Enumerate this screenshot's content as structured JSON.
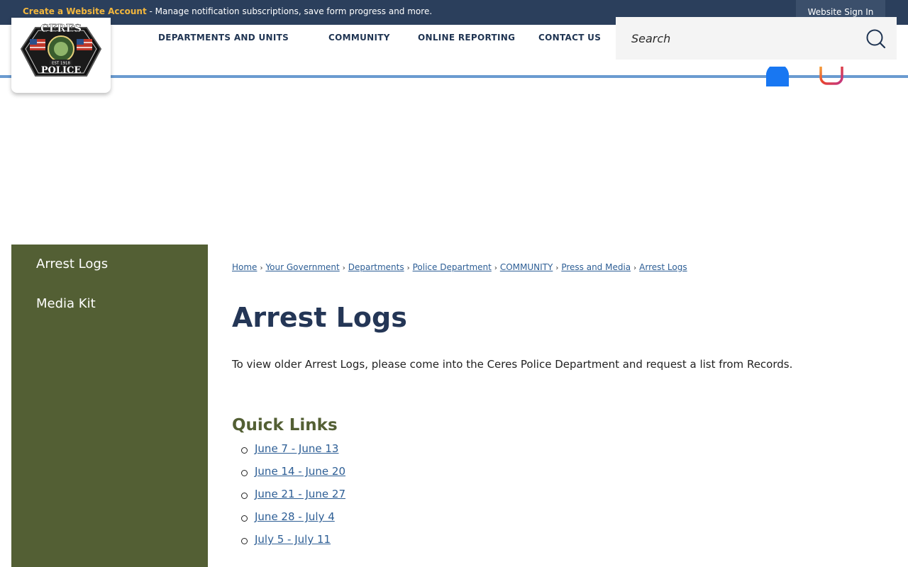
{
  "topbar": {
    "create_account": "Create a Website Account",
    "message": " - Manage notification subscriptions, save form progress and more.",
    "signin": "Website Sign In"
  },
  "logo": {
    "top_text": "CERES",
    "bottom_text": "POLICE",
    "est": "EST 1918"
  },
  "nav": {
    "departments": "DEPARTMENTS AND UNITS",
    "community": "COMMUNITY",
    "online_reporting": "ONLINE REPORTING",
    "contact": "CONTACT US"
  },
  "search": {
    "placeholder": "Search"
  },
  "sidebar": {
    "items": [
      {
        "label": "Arrest Logs"
      },
      {
        "label": "Media Kit"
      }
    ]
  },
  "breadcrumb": [
    {
      "label": "Home"
    },
    {
      "label": "Your Government"
    },
    {
      "label": "Departments"
    },
    {
      "label": "Police Department"
    },
    {
      "label": "COMMUNITY"
    },
    {
      "label": "Press and Media"
    },
    {
      "label": "Arrest Logs"
    }
  ],
  "breadcrumb_sep": "›",
  "page": {
    "title": "Arrest Logs",
    "description": "To view older Arrest Logs, please come into the Ceres Police Department and request a list from Records.",
    "quick_links_title": "Quick Links",
    "quick_links": [
      {
        "label": "June 7 - June 13"
      },
      {
        "label": "June 14 - June 20"
      },
      {
        "label": "June 21 - June 27"
      },
      {
        "label": "June 28 - July 4"
      },
      {
        "label": "July 5 - July 11"
      }
    ]
  },
  "colors": {
    "topbar": "#2b3f5c",
    "accent_gold": "#f2b63d",
    "sidebar": "#535f34",
    "title": "#243656",
    "link": "#2d5e95"
  },
  "icons": [
    "search-icon",
    "facebook-icon",
    "instagram-icon",
    "police-badge-logo"
  ]
}
